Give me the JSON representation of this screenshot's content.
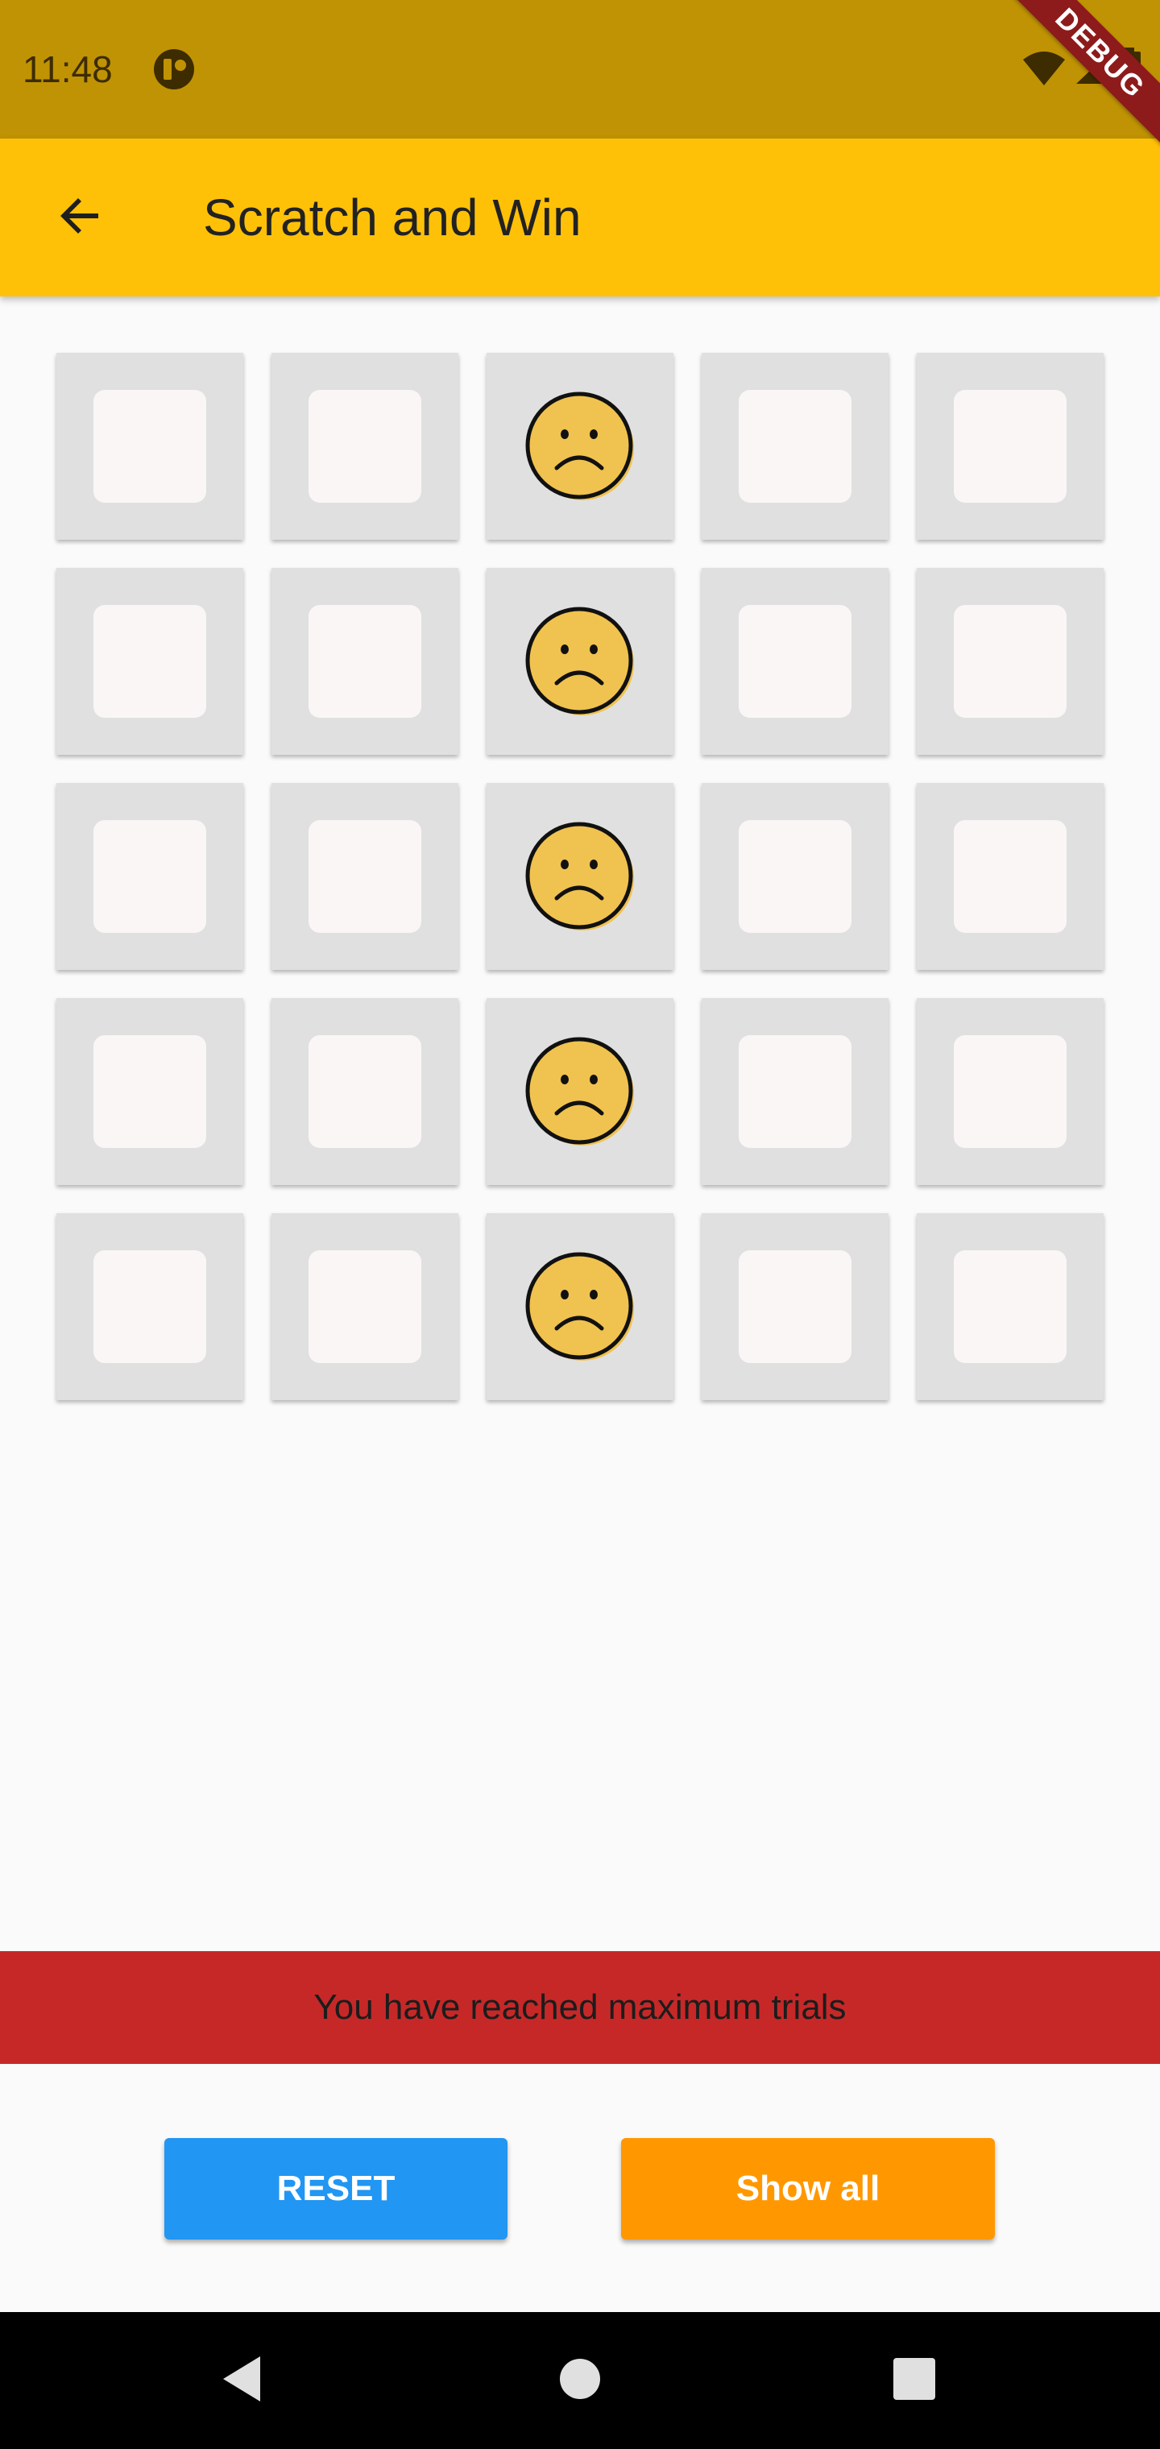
{
  "status_bar": {
    "time": "11:48",
    "app_icon": "notification-app-icon",
    "icons": [
      "wifi-icon",
      "signal-icon",
      "battery-icon"
    ],
    "background": "#c09304"
  },
  "debug_banner": {
    "label": "DEBUG"
  },
  "app_bar": {
    "back_icon": "arrow-back-icon",
    "title": "Scratch and Win",
    "background": "#ffc107"
  },
  "grid": {
    "rows": 5,
    "columns": 5,
    "tiles": [
      [
        "hidden",
        "hidden",
        "sad-face",
        "hidden",
        "hidden"
      ],
      [
        "hidden",
        "hidden",
        "sad-face",
        "hidden",
        "hidden"
      ],
      [
        "hidden",
        "hidden",
        "sad-face",
        "hidden",
        "hidden"
      ],
      [
        "hidden",
        "hidden",
        "sad-face",
        "hidden",
        "hidden"
      ],
      [
        "hidden",
        "hidden",
        "sad-face",
        "hidden",
        "hidden"
      ]
    ],
    "tile_color": "#e0e0e0",
    "face_color": "#f0c24f"
  },
  "message": {
    "text": "You have reached maximum trials",
    "background": "#c62828"
  },
  "buttons": {
    "reset_label": "RESET",
    "reset_color": "#2196f3",
    "show_all_label": "Show all",
    "show_all_color": "#ff9800"
  },
  "nav_bar": {
    "icons": [
      "nav-back-icon",
      "nav-home-icon",
      "nav-recents-icon"
    ]
  }
}
